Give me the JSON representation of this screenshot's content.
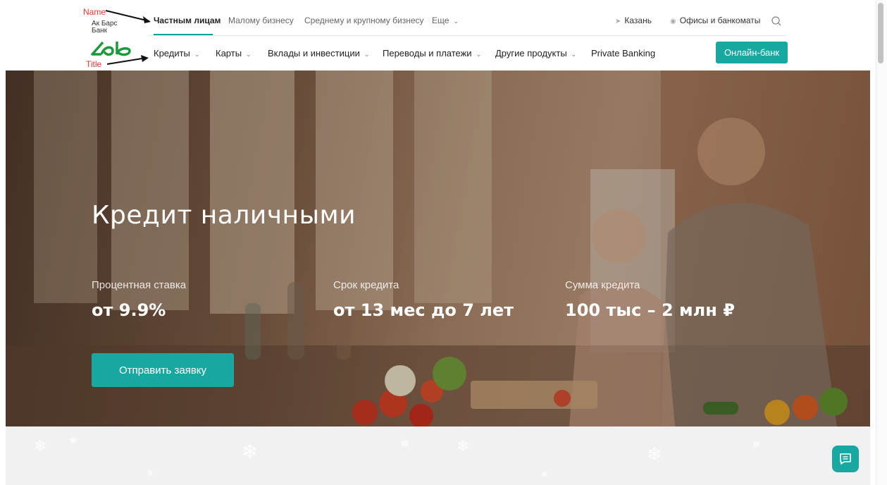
{
  "annotations": {
    "name_label": "Name",
    "title_label": "Title"
  },
  "brand": {
    "line1": "Ак Барс",
    "line2": "Банк"
  },
  "segments": [
    {
      "label": "Частным лицам",
      "active": true
    },
    {
      "label": "Малому бизнесу",
      "active": false
    },
    {
      "label": "Среднему и крупному бизнесу",
      "active": false
    },
    {
      "label": "Еще",
      "active": false
    }
  ],
  "top_right": {
    "city": "Казань",
    "offices": "Офисы и банкоматы"
  },
  "menu": [
    {
      "label": "Кредиты"
    },
    {
      "label": "Карты"
    },
    {
      "label": "Вклады и инвестиции"
    },
    {
      "label": "Переводы и платежи"
    },
    {
      "label": "Другие продукты"
    },
    {
      "label": "Private Banking"
    }
  ],
  "online_bank_button": "Онлайн-банк",
  "hero": {
    "title": "Кредит наличными",
    "stats": [
      {
        "label": "Процентная ставка",
        "value": "от 9.9%"
      },
      {
        "label": "Срок кредита",
        "value": "от 13 мес до 7 лет"
      },
      {
        "label": "Сумма кредита",
        "value": "100 тыс – 2 млн ₽"
      }
    ],
    "cta_label": "Отправить заявку"
  },
  "colors": {
    "accent": "#17a8a0",
    "annotation": "#e53935"
  },
  "icons": [
    "location-arrow-icon",
    "map-pin-icon",
    "search-icon",
    "chat-icon",
    "chevron-down-icon"
  ]
}
